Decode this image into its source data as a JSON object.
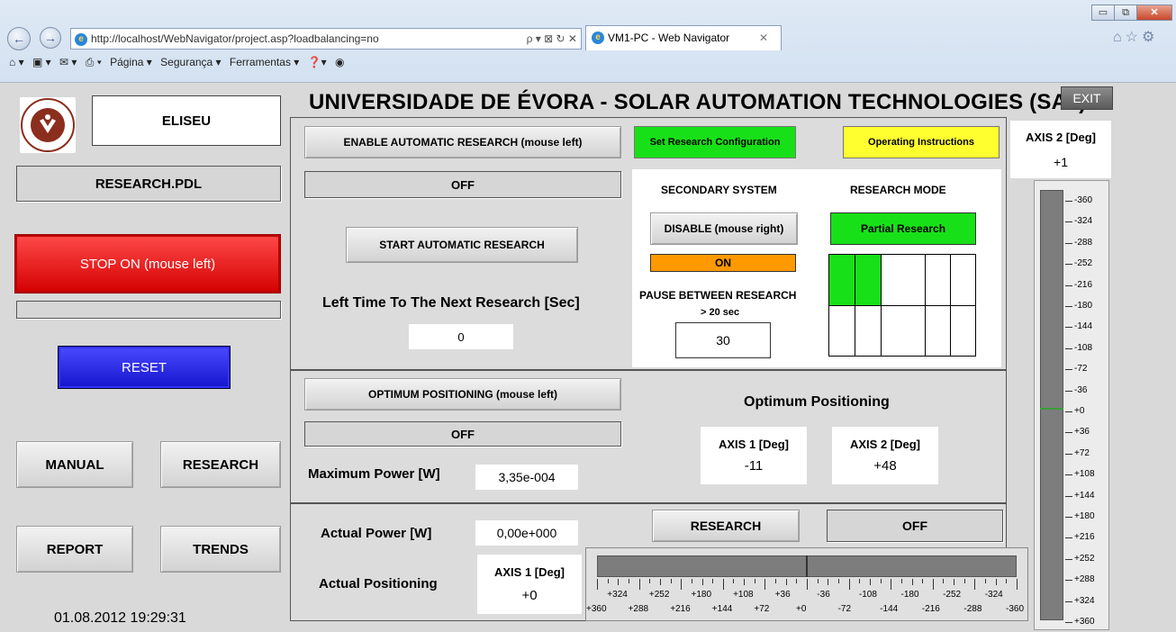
{
  "browser": {
    "url": "http://localhost/WebNavigator/project.asp?loadbalancing=no",
    "address_tools": "ρ ▾ ⊠ ↻ ✕",
    "tab_title": "VM1-PC - Web Navigator",
    "tab_close": "✕",
    "window_minimize": "▭",
    "window_maximize": "⧉",
    "window_close": "✕",
    "home_icon": "⌂",
    "star_icon": "☆",
    "gear_icon": "⚙",
    "back_icon": "←",
    "forward_icon": "→",
    "cmd_home": "⌂ ▾",
    "cmd_feeds": "▣ ▾",
    "cmd_mail": "✉ ▾",
    "cmd_print": "⎙ ▾",
    "cmd_page": "Página ▾",
    "cmd_security": "Segurança ▾",
    "cmd_tools": "Ferramentas ▾",
    "cmd_help": "❓▾",
    "cmd_extra": "◉"
  },
  "app": {
    "title": "UNIVERSIDADE DE ÉVORA - SOLAR AUTOMATION TECHNOLOGIES (SAT)",
    "exit_label": "EXIT",
    "logo_text": "UNIVERSIDADE DE ÉVORA",
    "user": "ELISEU",
    "program": "RESEARCH.PDL",
    "stop_label": "STOP ON (mouse left)",
    "reset_label": "RESET",
    "manual_label": "MANUAL",
    "research_nav_label": "RESEARCH",
    "report_label": "REPORT",
    "trends_label": "TRENDS",
    "datetime": "01.08.2012 19:29:31"
  },
  "research": {
    "enable_button": "ENABLE AUTOMATIC RESEARCH (mouse left)",
    "enable_status": "OFF",
    "start_button": "START AUTOMATIC RESEARCH",
    "left_time_label": "Left Time To The Next Research [Sec]",
    "left_time_value": "0",
    "set_config_button": "Set Research Configuration",
    "instructions_button": "Operating Instructions",
    "secondary_system_label": "SECONDARY SYSTEM",
    "disable_button": "DISABLE (mouse right)",
    "secondary_status": "ON",
    "pause_label": "PAUSE BETWEEN RESEARCH",
    "pause_hint": "> 20 sec",
    "pause_value": "30",
    "research_mode_label": "RESEARCH MODE",
    "research_mode_value": "Partial Research"
  },
  "optimum": {
    "button": "OPTIMUM POSITIONING (mouse left)",
    "status": "OFF",
    "title": "Optimum Positioning",
    "axis1_label": "AXIS 1 [Deg]",
    "axis1_value": "-11",
    "axis2_label": "AXIS 2 [Deg]",
    "axis2_value": "+48",
    "max_power_label": "Maximum Power [W]",
    "max_power_value": "3,35e-004"
  },
  "actual": {
    "power_label": "Actual Power [W]",
    "power_value": "0,00e+000",
    "positioning_label": "Actual Positioning",
    "axis1_label": "AXIS 1 [Deg]",
    "axis1_value": "+0",
    "research_button": "RESEARCH",
    "research_status": "OFF"
  },
  "axis2": {
    "label": "AXIS 2 [Deg]",
    "value": "+1",
    "scale": [
      "-360",
      "-324",
      "-288",
      "-252",
      "-216",
      "-180",
      "-144",
      "-108",
      "-72",
      "-36",
      "+0",
      "+36",
      "+72",
      "+108",
      "+144",
      "+180",
      "+216",
      "+252",
      "+288",
      "+324",
      "+360"
    ]
  },
  "hscale": {
    "upper": [
      "+324",
      "+252",
      "+180",
      "+108",
      "+36",
      "-36",
      "-108",
      "-180",
      "-252",
      "-324"
    ],
    "lower": [
      "+360",
      "+288",
      "+216",
      "+144",
      "+72",
      "+0",
      "-72",
      "-144",
      "-216",
      "-288",
      "-360"
    ]
  },
  "colors": {
    "stop": "#e41515",
    "reset": "#2222e0",
    "green": "#18e018",
    "yellow": "#ffff30",
    "orange": "#ff9900"
  }
}
